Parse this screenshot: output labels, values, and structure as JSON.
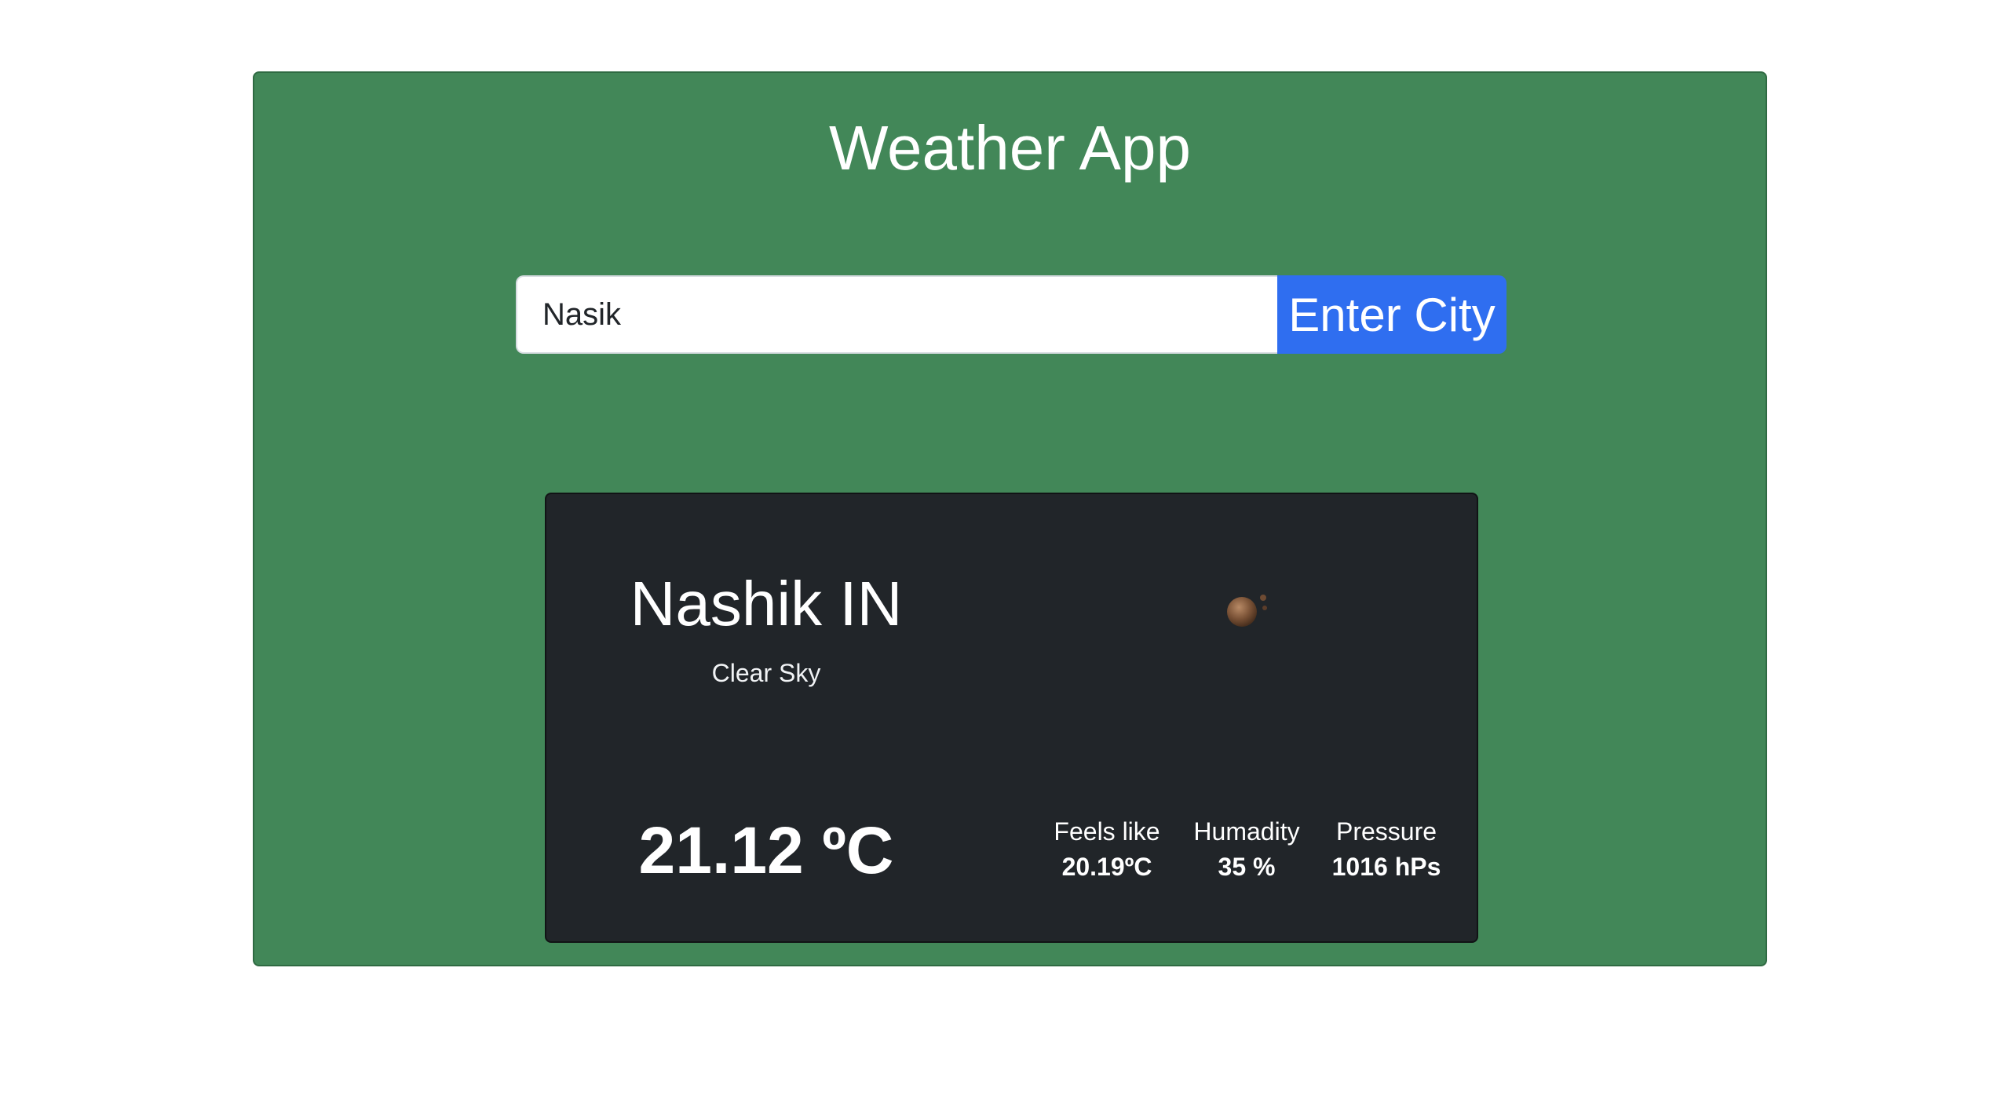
{
  "header": {
    "title": "Weather App"
  },
  "search": {
    "value": "Nasik",
    "button_label": "Enter City"
  },
  "weather": {
    "city": "Nashik IN",
    "condition": "Clear Sky",
    "icon": "clear-night-moon-icon",
    "temperature": "21.12 ºC",
    "stats": [
      {
        "label": "Feels like",
        "value": "20.19ºC"
      },
      {
        "label": "Humadity",
        "value": "35 %"
      },
      {
        "label": "Pressure",
        "value": "1016 hPs"
      }
    ]
  },
  "colors": {
    "panel_bg": "#428758",
    "card_bg": "#212529",
    "button_bg": "#2f6ef0"
  }
}
